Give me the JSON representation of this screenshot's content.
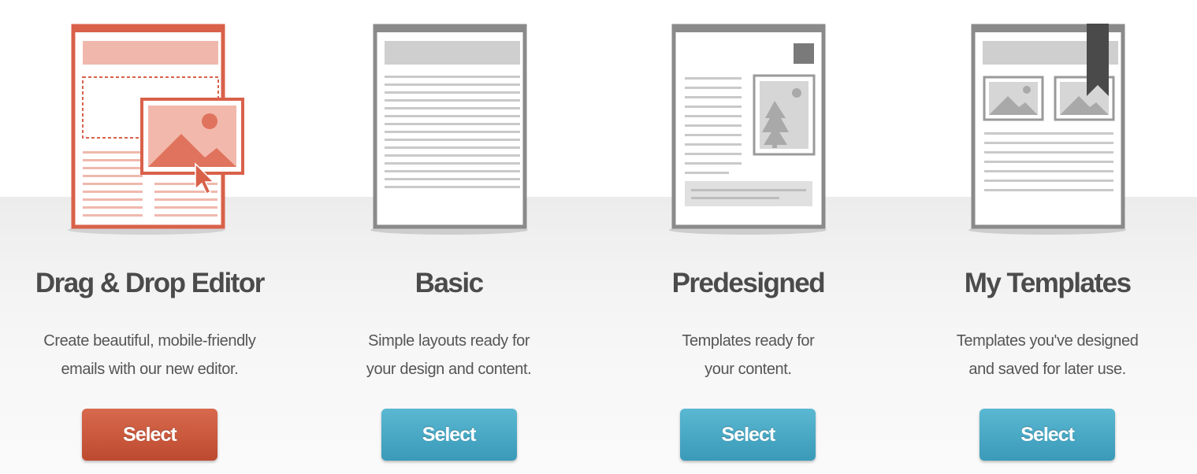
{
  "colors": {
    "accent_red": "#c8553a",
    "accent_blue": "#49a9c5",
    "doc_gray": "#8a8a8a",
    "title_text": "#4b4b4b",
    "desc_text": "#555555"
  },
  "options": [
    {
      "title": "Drag & Drop Editor",
      "desc_line1": "Create beautiful, mobile-friendly",
      "desc_line2": "emails with our new editor.",
      "button_label": "Select",
      "icon": "drag-drop-editor-icon",
      "button_color": "#c8553a"
    },
    {
      "title": "Basic",
      "desc_line1": "Simple layouts ready for",
      "desc_line2": "your design and content.",
      "button_label": "Select",
      "icon": "basic-template-icon",
      "button_color": "#49a9c5"
    },
    {
      "title": "Predesigned",
      "desc_line1": "Templates ready for",
      "desc_line2": "your content.",
      "button_label": "Select",
      "icon": "predesigned-template-icon",
      "button_color": "#49a9c5"
    },
    {
      "title": "My Templates",
      "desc_line1": "Templates you've designed",
      "desc_line2": "and saved for later use.",
      "button_label": "Select",
      "icon": "my-templates-icon",
      "button_color": "#49a9c5"
    }
  ]
}
